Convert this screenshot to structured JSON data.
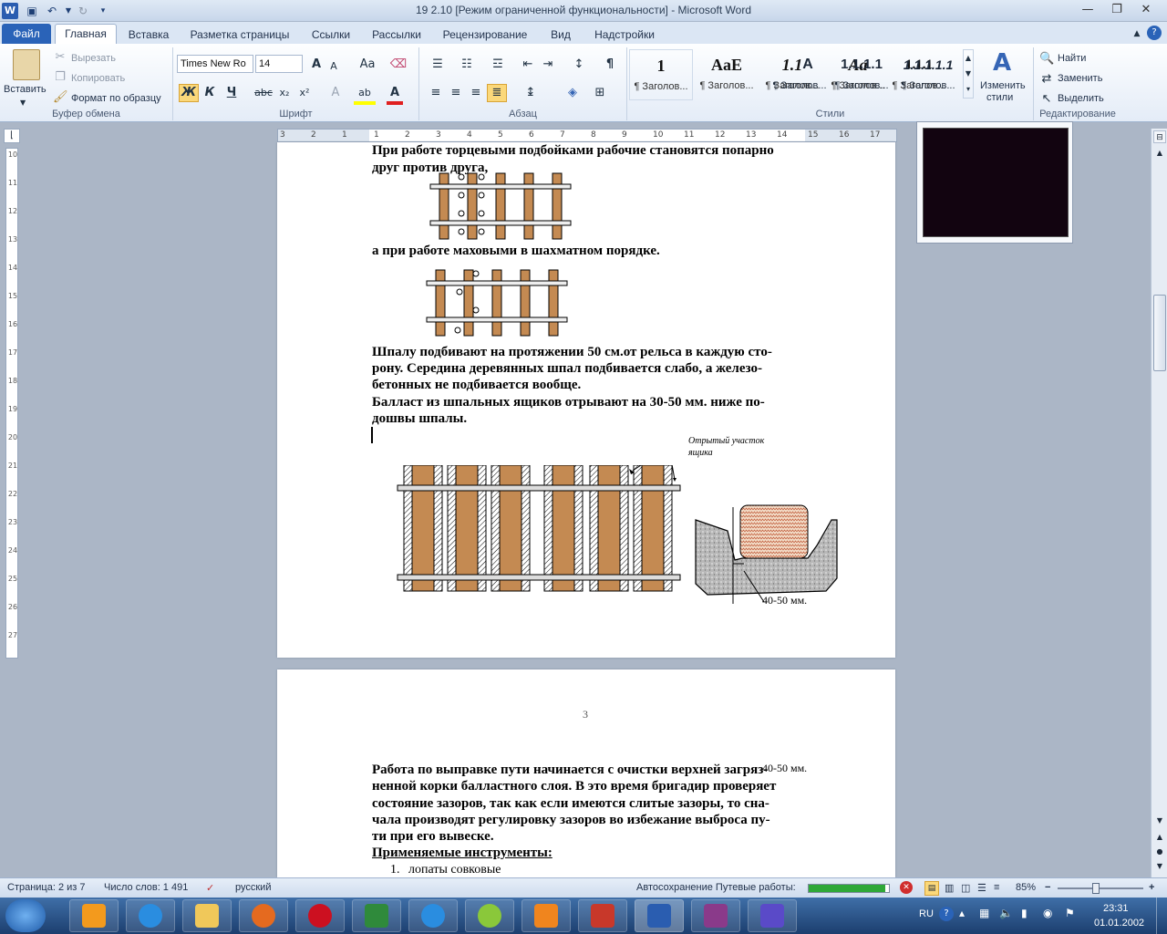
{
  "titlebar": {
    "title": "19  2.10 [Режим ограниченной функциональности]  -  Microsoft Word",
    "minimize": "—",
    "restore": "❐",
    "close": "✕"
  },
  "tabs": [
    {
      "label": "Файл"
    },
    {
      "label": "Главная"
    },
    {
      "label": "Вставка"
    },
    {
      "label": "Разметка страницы"
    },
    {
      "label": "Ссылки"
    },
    {
      "label": "Рассылки"
    },
    {
      "label": "Рецензирование"
    },
    {
      "label": "Вид"
    },
    {
      "label": "Надстройки"
    }
  ],
  "ribbon": {
    "clipboard": {
      "paste": "Вставить",
      "cut": "Вырезать",
      "copy": "Копировать",
      "format_painter": "Формат по образцу",
      "label": "Буфер обмена"
    },
    "font": {
      "name": "Times New Ro",
      "size": "14",
      "grow": "A",
      "shrink": "A",
      "change_case": "Aa",
      "bold": "Ж",
      "italic": "К",
      "underline": "Ч",
      "strike": "abc",
      "subscript": "x₂",
      "superscript": "x²",
      "highlight": "ab",
      "color": "A",
      "label": "Шрифт"
    },
    "paragraph": {
      "label": "Абзац",
      "pilcrow": "¶"
    },
    "styles": {
      "items": [
        {
          "preview": "1",
          "name": "¶ Заголов..."
        },
        {
          "preview": "AaE",
          "name": "¶ Заголов..."
        },
        {
          "preview": "1.1",
          "name": "¶ Заголов..."
        },
        {
          "preview": "Aa",
          "name": "¶ Заголов..."
        },
        {
          "preview": "1.1.1",
          "name": "¶ Заголов..."
        },
        {
          "preview": "A",
          "name": "¶ Заголов..."
        },
        {
          "preview": "1.1.1.1",
          "name": "¶ Заголов..."
        },
        {
          "preview": "1.1.1.1.1",
          "name": "¶ Заголов..."
        }
      ],
      "change_styles_line1": "Изменить",
      "change_styles_line2": "стили",
      "label": "Стили"
    },
    "editing": {
      "find": "Найти",
      "replace": "Заменить",
      "select": "Выделить",
      "label": "Редактирование"
    }
  },
  "hruler": [
    "3",
    "2",
    "1",
    "1",
    "2",
    "3",
    "4",
    "5",
    "6",
    "7",
    "8",
    "9",
    "10",
    "11",
    "12",
    "13",
    "14",
    "15",
    "16",
    "17"
  ],
  "vruler": [
    "10",
    "11",
    "12",
    "13",
    "14",
    "15",
    "16",
    "17",
    "18",
    "19",
    "20",
    "21",
    "22",
    "23",
    "24",
    "25",
    "26",
    "27"
  ],
  "document": {
    "page1_lines": [
      "При работе торцевыми подбойками рабочие становятся попарно",
      "друг против друга,"
    ],
    "line_checker": "а при работе маховыми в шахматном порядке.",
    "para_sleeper": [
      "Шпалу подбивают на протяжении 50 см.от рельса в каждую сто-",
      "рону. Середина деревянных шпал подбивается слабо, а железо-",
      "бетонных не подбивается вообще.",
      "Балласт из шпальных ящиков отрывают на 30-50 мм. ниже по-",
      "дошвы шпалы."
    ],
    "fig_label_open": "Отрытый участок",
    "fig_label_open2": "ящика",
    "fig_label_depth": "40-50  мм.",
    "page_number": "3",
    "page2_lines": [
      "Работа по выправке пути начинается с очистки верхней загряз-",
      "ненной корки балластного слоя. В это время бригадир проверяет",
      "состояние зазоров, так как если имеются слитые зазоры, то сна-",
      "чала производят регулировку зазоров во избежание выброса пу-",
      "ти при его вывеске."
    ],
    "page2_overlay": "40-50  мм.",
    "tools_heading": "Применяемые инструменты:",
    "list_item_1_num": "1.",
    "list_item_1": "лопаты совковые"
  },
  "status": {
    "page": "Страница: 2 из 7",
    "words": "Число слов: 1 491",
    "lang": "русский",
    "autosave": "Автосохранение Путевые работы:",
    "autosave_progress": 0.95,
    "zoom": "85%",
    "minus": "−",
    "plus": "+"
  },
  "taskbar": {
    "lang": "RU",
    "time": "23:31",
    "date": "01.01.2002"
  },
  "colors": {
    "accent": "#2a63b8",
    "sleeper": "#c48a52",
    "rail": "#d8d8d8",
    "progress": "#2fa838"
  }
}
